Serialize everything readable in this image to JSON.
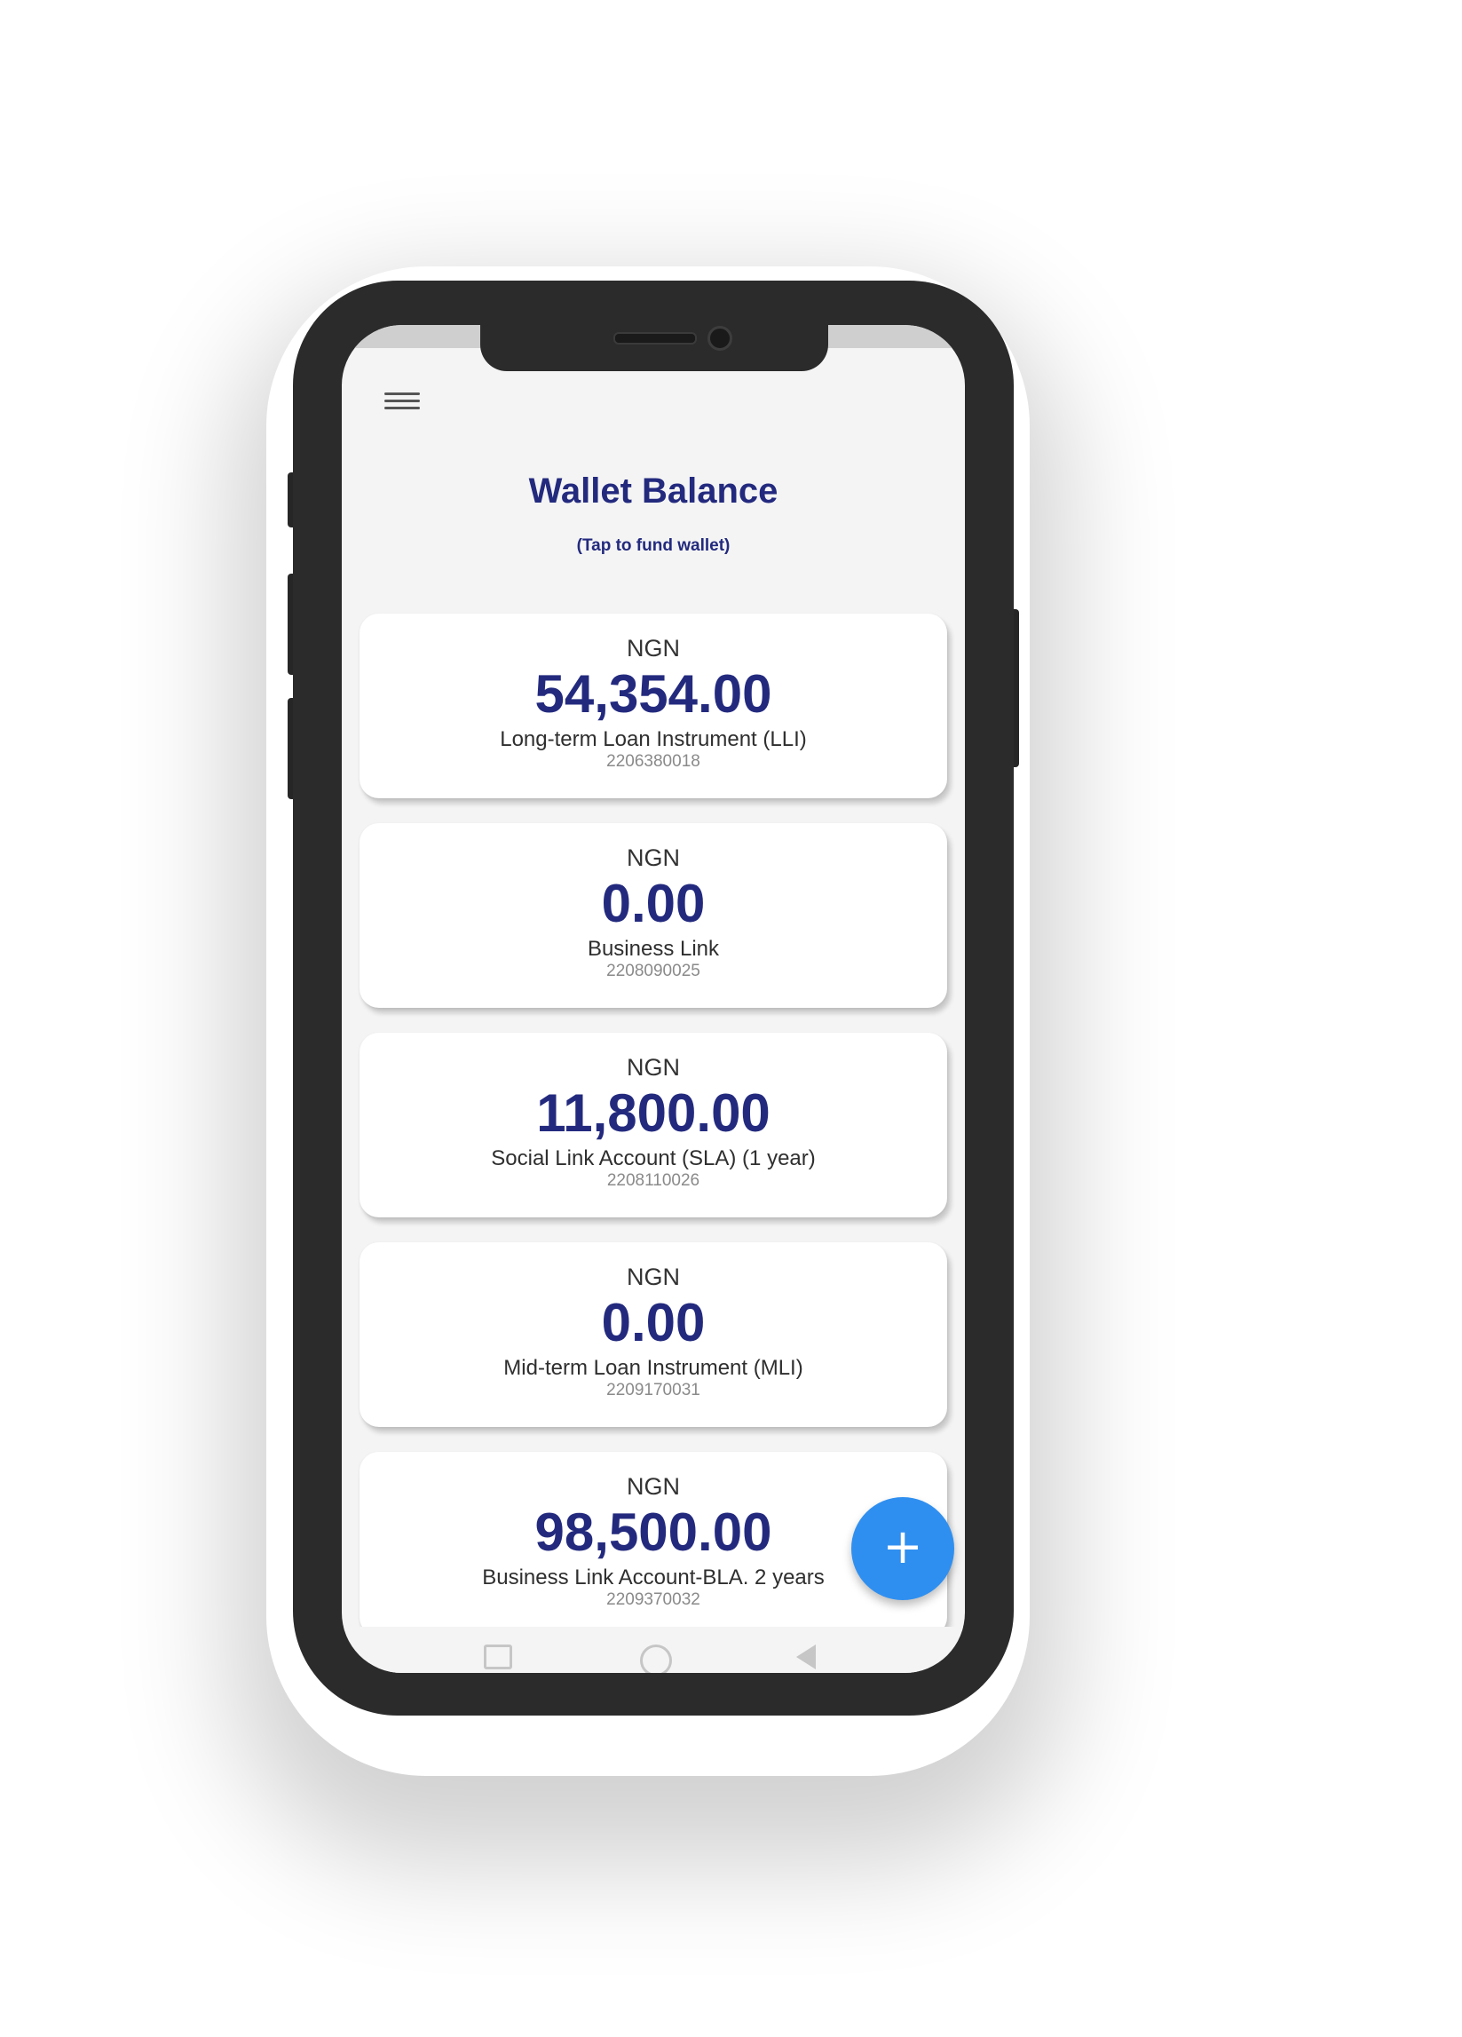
{
  "header": {
    "title": "Wallet Balance",
    "subtitle": "(Tap to fund wallet)"
  },
  "wallets": [
    {
      "currency": "NGN",
      "amount": "54,354.00",
      "name": "Long-term Loan Instrument (LLI)",
      "account_no": "2206380018"
    },
    {
      "currency": "NGN",
      "amount": "0.00",
      "name": "Business Link",
      "account_no": "2208090025"
    },
    {
      "currency": "NGN",
      "amount": "11,800.00",
      "name": "Social Link Account (SLA) (1 year)",
      "account_no": "2208110026"
    },
    {
      "currency": "NGN",
      "amount": "0.00",
      "name": "Mid-term Loan Instrument (MLI)",
      "account_no": "2209170031"
    },
    {
      "currency": "NGN",
      "amount": "98,500.00",
      "name": "Business Link Account-BLA. 2 years",
      "account_no": "2209370032"
    }
  ],
  "fab": {
    "label": "+"
  },
  "colors": {
    "brand": "#232a7e",
    "fab": "#2f8ff0",
    "background": "#f4f4f4"
  },
  "icons": {
    "menu": "hamburger-menu-icon",
    "fab": "plus-icon",
    "nav_recent": "square-icon",
    "nav_home": "circle-icon",
    "nav_back": "triangle-back-icon"
  }
}
